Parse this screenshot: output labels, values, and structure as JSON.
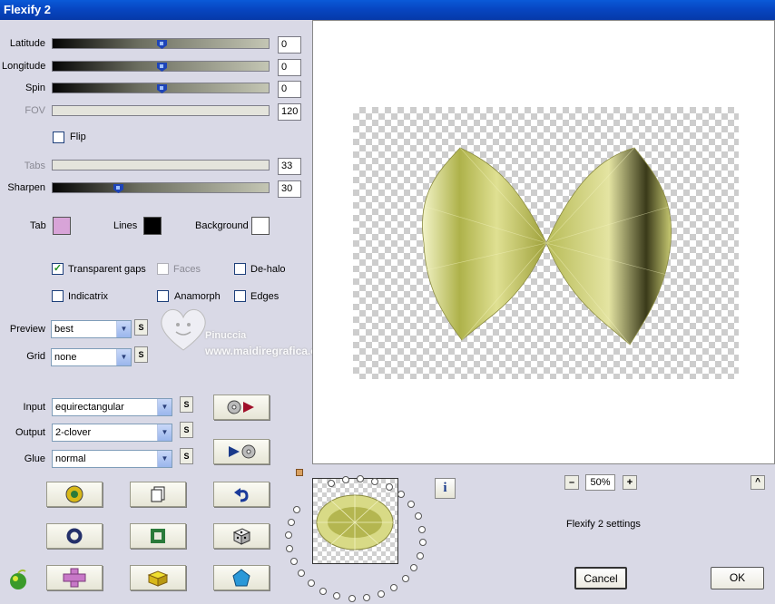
{
  "window": {
    "title": "Flexify 2"
  },
  "sliders": [
    {
      "label": "Latitude",
      "value": "0",
      "level": 0.5,
      "enabled": true
    },
    {
      "label": "Longitude",
      "value": "0",
      "level": 0.5,
      "enabled": true
    },
    {
      "label": "Spin",
      "value": "0",
      "level": 0.5,
      "enabled": true
    },
    {
      "label": "FOV",
      "value": "120",
      "enabled": false
    },
    {
      "label": "Tabs",
      "value": "33",
      "enabled": false
    },
    {
      "label": "Sharpen",
      "value": "30",
      "level": 0.3,
      "enabled": true
    }
  ],
  "flip": {
    "label": "Flip",
    "checked": false
  },
  "colors": {
    "tab": {
      "label": "Tab",
      "color": "#d8a4d8"
    },
    "lines": {
      "label": "Lines",
      "color": "#000000"
    },
    "background": {
      "label": "Background",
      "color": "#ffffff"
    }
  },
  "options": {
    "transparent_gaps": {
      "label": "Transparent gaps",
      "checked": true
    },
    "faces": {
      "label": "Faces",
      "checked": false
    },
    "de_halo": {
      "label": "De-halo",
      "checked": false
    },
    "indicatrix": {
      "label": "Indicatrix",
      "checked": false
    },
    "anamorph": {
      "label": "Anamorph",
      "checked": false
    },
    "edges": {
      "label": "Edges",
      "checked": false
    }
  },
  "selects": {
    "preview": {
      "label": "Preview",
      "value": "best"
    },
    "grid": {
      "label": "Grid",
      "value": "none"
    },
    "input": {
      "label": "Input",
      "value": "equirectangular"
    },
    "output": {
      "label": "Output",
      "value": "2-clover"
    },
    "glue": {
      "label": "Glue",
      "value": "normal"
    }
  },
  "s_label": "S",
  "watermark": {
    "name": "Pinuccia",
    "url": "www.maidiregrafica.eu"
  },
  "zoom": {
    "minus": "–",
    "value": "50%",
    "plus": "+"
  },
  "info_label": "i",
  "caret_label": "^",
  "status": "Flexify 2 settings",
  "buttons": {
    "cancel": "Cancel",
    "ok": "OK"
  }
}
